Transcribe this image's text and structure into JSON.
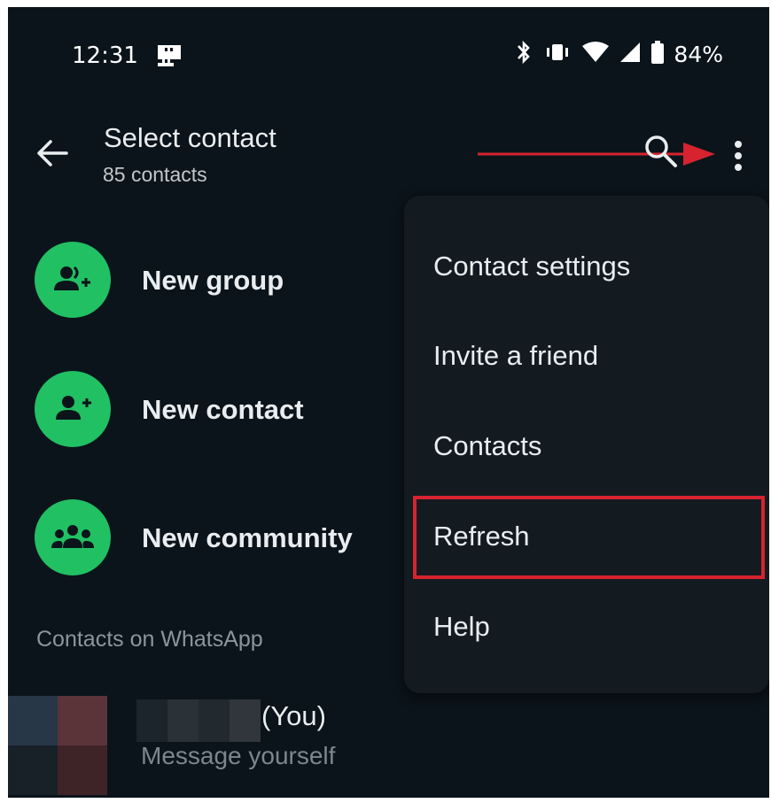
{
  "status_bar": {
    "time": "12:31",
    "battery_percent": "84%",
    "icons": [
      "notification-app-icon",
      "bluetooth-icon",
      "vibrate-icon",
      "wifi-icon",
      "cell-signal-icon",
      "battery-icon"
    ]
  },
  "header": {
    "title": "Select contact",
    "subtitle": "85 contacts",
    "icons": [
      "back-arrow-icon",
      "search-icon",
      "more-vert-icon"
    ]
  },
  "actions": [
    {
      "label": "New group",
      "icon": "group-add-icon"
    },
    {
      "label": "New contact",
      "icon": "person-add-icon"
    },
    {
      "label": "New community",
      "icon": "community-icon"
    }
  ],
  "section_header": "Contacts on WhatsApp",
  "self_contact": {
    "name_suffix": "(You)",
    "subtitle": "Message yourself"
  },
  "overflow_menu": {
    "items": [
      "Contact settings",
      "Invite a friend",
      "Contacts",
      "Refresh",
      "Help"
    ],
    "highlighted_item": "Refresh"
  },
  "colors": {
    "background": "#0b141b",
    "menu_background": "#131b21",
    "accent_green": "#21c063",
    "annotation_red": "#d6232f",
    "primary_text": "#e9edef",
    "secondary_text": "#8a969c"
  }
}
